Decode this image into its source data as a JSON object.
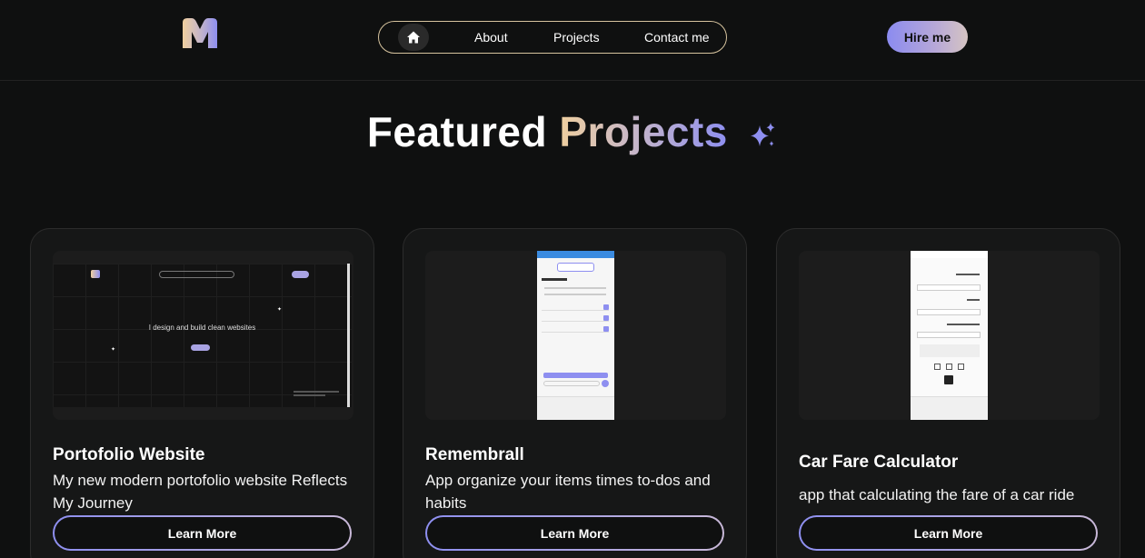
{
  "header": {
    "nav": {
      "links": [
        "About",
        "Projects",
        "Contact me"
      ]
    },
    "hire_label": "Hire me"
  },
  "section": {
    "title_plain": "Featured",
    "title_gradient": "Projects"
  },
  "projects": [
    {
      "title": "Portofolio Website",
      "description": "My new modern portofolio website Reflects My Journey",
      "button": "Learn More",
      "preview_heading": "I design and build clean websites"
    },
    {
      "title": "Remembrall",
      "description": "App organize your items times to-dos and habits",
      "button": "Learn More"
    },
    {
      "title": "Car Fare Calculator",
      "description": "app that calculating the fare of a car ride",
      "button": "Learn More"
    }
  ],
  "colors": {
    "background": "#0f1010",
    "accent_gold": "#efcf9f",
    "accent_purple": "#8e8ff0"
  },
  "icons": {
    "logo": "m-logo-icon",
    "home": "home-icon",
    "sparkle": "sparkles-icon"
  }
}
